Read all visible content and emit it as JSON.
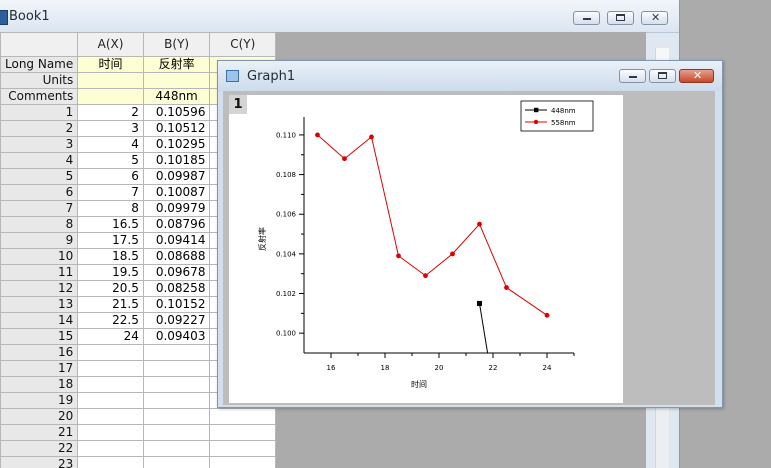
{
  "book": {
    "title": "Book1",
    "columns": [
      "A(X)",
      "B(Y)",
      "C(Y)"
    ],
    "row_labels": {
      "long_name": "Long Name",
      "units": "Units",
      "comments": "Comments"
    },
    "long_names": [
      "时间",
      "反射率",
      ""
    ],
    "units": [
      "",
      "",
      ""
    ],
    "comments": [
      "",
      "448nm",
      ""
    ],
    "rows": [
      {
        "n": "1",
        "a": "2",
        "b": "0.10596"
      },
      {
        "n": "2",
        "a": "3",
        "b": "0.10512"
      },
      {
        "n": "3",
        "a": "4",
        "b": "0.10295"
      },
      {
        "n": "4",
        "a": "5",
        "b": "0.10185"
      },
      {
        "n": "5",
        "a": "6",
        "b": "0.09987"
      },
      {
        "n": "6",
        "a": "7",
        "b": "0.10087"
      },
      {
        "n": "7",
        "a": "8",
        "b": "0.09979"
      },
      {
        "n": "8",
        "a": "16.5",
        "b": "0.08796"
      },
      {
        "n": "9",
        "a": "17.5",
        "b": "0.09414"
      },
      {
        "n": "10",
        "a": "18.5",
        "b": "0.08688"
      },
      {
        "n": "11",
        "a": "19.5",
        "b": "0.09678"
      },
      {
        "n": "12",
        "a": "20.5",
        "b": "0.08258"
      },
      {
        "n": "13",
        "a": "21.5",
        "b": "0.10152"
      },
      {
        "n": "14",
        "a": "22.5",
        "b": "0.09227"
      },
      {
        "n": "15",
        "a": "24",
        "b": "0.09403"
      },
      {
        "n": "16",
        "a": "",
        "b": ""
      },
      {
        "n": "17",
        "a": "",
        "b": ""
      },
      {
        "n": "18",
        "a": "",
        "b": ""
      },
      {
        "n": "19",
        "a": "",
        "b": ""
      },
      {
        "n": "20",
        "a": "",
        "b": ""
      },
      {
        "n": "21",
        "a": "",
        "b": ""
      },
      {
        "n": "22",
        "a": "",
        "b": ""
      },
      {
        "n": "23",
        "a": "",
        "b": ""
      }
    ]
  },
  "graph": {
    "title": "Graph1",
    "layer_label": "1"
  },
  "chart_data": {
    "type": "line",
    "title": "",
    "xlabel": "时间",
    "ylabel": "反射率",
    "xlim": [
      15,
      25
    ],
    "ylim": [
      0.099,
      0.1105
    ],
    "x_ticks": [
      "16",
      "18",
      "20",
      "22",
      "24"
    ],
    "y_ticks": [
      "0.100",
      "0.102",
      "0.104",
      "0.106",
      "0.108",
      "0.110"
    ],
    "legend_position": "top-right",
    "grid": false,
    "series": [
      {
        "name": "448nm",
        "color": "#000000",
        "marker": "square",
        "x": [
          21.5,
          21.5,
          21.8
        ],
        "y": [
          0.1015,
          0.1015,
          0.099
        ]
      },
      {
        "name": "558nm",
        "color": "#dd0000",
        "marker": "circle",
        "x": [
          15.5,
          16.5,
          17.5,
          18.5,
          19.5,
          20.5,
          21.5,
          22.5,
          24
        ],
        "y": [
          0.11,
          0.1088,
          0.1099,
          0.1039,
          0.1029,
          0.104,
          0.1055,
          0.1023,
          0.1009
        ]
      }
    ]
  }
}
